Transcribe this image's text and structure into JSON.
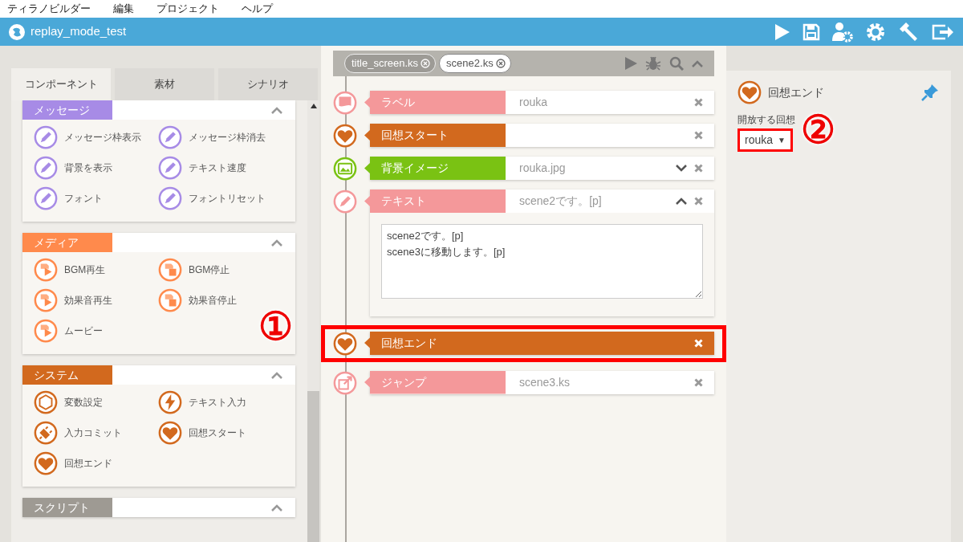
{
  "menu": [
    "ティラノビルダー",
    "編集",
    "プロジェクト",
    "ヘルプ"
  ],
  "title_bar": {
    "title": "replay_mode_test"
  },
  "left_tabs": [
    {
      "label": "コンポーネント",
      "selected": true
    },
    {
      "label": "素材",
      "selected": false
    },
    {
      "label": "シナリオ",
      "selected": false
    }
  ],
  "component_groups": [
    {
      "title": "メッセージ",
      "color": "#a78be6",
      "expanded": true,
      "items": [
        {
          "label": "メッセージ枠表示",
          "kind": "text"
        },
        {
          "label": "メッセージ枠消去",
          "kind": "text"
        },
        {
          "label": "背景を表示",
          "kind": "text"
        },
        {
          "label": "テキスト速度",
          "kind": "text"
        },
        {
          "label": "フォント",
          "kind": "text"
        },
        {
          "label": "フォントリセット",
          "kind": "text"
        }
      ]
    },
    {
      "title": "メディア",
      "color": "#ff8a4c",
      "expanded": true,
      "items": [
        {
          "label": "BGM再生",
          "kind": "media-play"
        },
        {
          "label": "BGM停止",
          "kind": "media-stop"
        },
        {
          "label": "効果音再生",
          "kind": "media-play"
        },
        {
          "label": "効果音停止",
          "kind": "media-stop"
        },
        {
          "label": "ムービー",
          "kind": "media-play"
        }
      ]
    },
    {
      "title": "システム",
      "color": "#d2691e",
      "expanded": true,
      "items": [
        {
          "label": "変数設定",
          "kind": "variable"
        },
        {
          "label": "テキスト入力",
          "kind": "trigger"
        },
        {
          "label": "入力コミット",
          "kind": "commit"
        },
        {
          "label": "回想スタート",
          "kind": "replay"
        },
        {
          "label": "回想エンド",
          "kind": "replay"
        }
      ]
    },
    {
      "title": "スクリプト",
      "color": "#9e9a93",
      "expanded": true
    }
  ],
  "scenario_tabs": [
    {
      "label": "title_screen.ks",
      "selected": false
    },
    {
      "label": "scene2.ks",
      "selected": true
    }
  ],
  "scenario_rows": [
    {
      "kind": "label",
      "title": "ラベル",
      "value": "rouka",
      "color": "#f4989a",
      "selected": false
    },
    {
      "kind": "replay",
      "title": "回想スタート",
      "color": "#d2691e",
      "selected": false
    },
    {
      "kind": "image",
      "title": "背景イメージ",
      "value": "rouka.jpg",
      "color": "#7ac213",
      "selected": false,
      "expanded": false
    },
    {
      "kind": "text",
      "title": "テキスト",
      "value": "scene2です。[p]",
      "color": "#f4989a",
      "selected": false,
      "expanded": true,
      "body": "scene2です。[p]\nscene3に移動します。[p]"
    },
    {
      "kind": "replay",
      "title": "回想エンド",
      "color": "#d2691e",
      "selected": true
    },
    {
      "kind": "jump",
      "title": "ジャンプ",
      "value": "scene3.ks",
      "color": "#f4989a",
      "selected": false
    }
  ],
  "inspector": {
    "title": "回想エンド",
    "kind": "replay",
    "color": "#d2691e",
    "field_label": "開放する回想",
    "field_value": "rouka",
    "dropdown_glyph": "▼",
    "highlighted": true
  },
  "callouts": [
    {
      "label": "①"
    },
    {
      "label": "②"
    }
  ]
}
